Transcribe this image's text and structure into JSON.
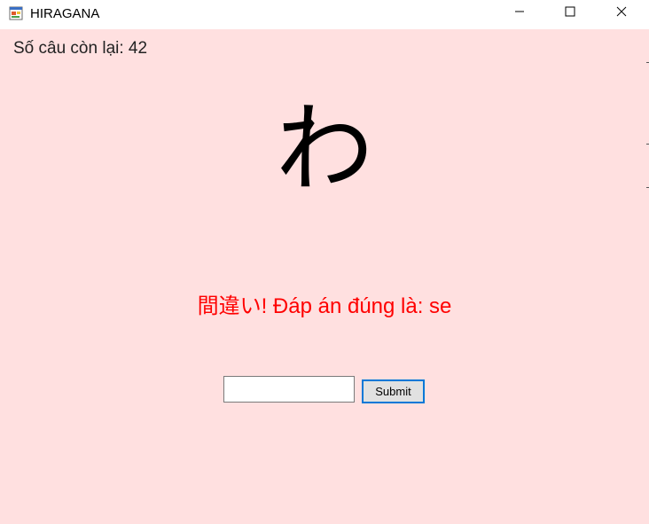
{
  "window": {
    "title": "HIRAGANA",
    "background": "#ffe0e0",
    "icons": {
      "app": "app-window-icon",
      "minimize": "minimize-icon",
      "maximize": "maximize-icon",
      "close": "close-icon"
    }
  },
  "quiz": {
    "remaining_text": "Số câu còn lại: 42",
    "character": "わ",
    "feedback": "間違い! Đáp án đúng là: se",
    "feedback_color": "#ff0000"
  },
  "answer": {
    "value": "",
    "placeholder": ""
  },
  "submit": {
    "label": "Submit",
    "border_color": "#0078d7"
  }
}
